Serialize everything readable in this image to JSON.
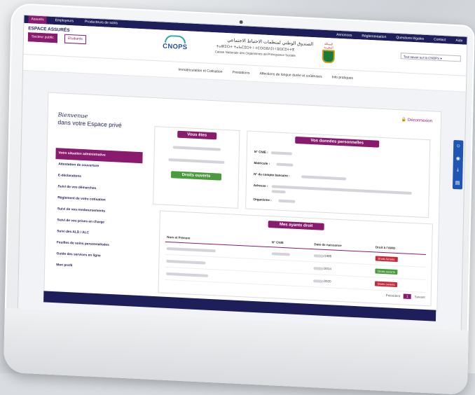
{
  "topbar": {
    "tabs": [
      "Assurés",
      "Employeurs",
      "Producteurs de soins"
    ],
    "right_links": [
      "Annonces",
      "Réglementation",
      "Questions légales",
      "Contact",
      "Aide"
    ]
  },
  "header": {
    "espace_title": "ESPACE ASSURÉS",
    "sector_public": "Secteur public",
    "students": "Etudiants",
    "logo_text": "CNOPS",
    "arabic_name": "الصندوق الوطني لمنظمات الاحتياط الاجتماعي",
    "tifinagh_name": "ⵜⴰⵏⴽⵉⵔⵜ ⵜⴰⵏⴰⵎⵓⵔⵜ ⵏ ⵜⵎⵙⵙⵓⴷⵉⵏ ⵏ ⵓⵙⵎⵓⵜⵜⴳ",
    "french_name": "Caisse Nationale des Organismes de Prévoyance Sociale",
    "emblem_label": "المملكة المغربية",
    "search_label": "Tout savoir sur la CNOPS"
  },
  "nav": [
    "Immatriculation et Cotisation",
    "Prestations",
    "Affections de longue durée et coûteuses",
    "Info pratiques"
  ],
  "deconnexion": "Déconnexion",
  "welcome": {
    "line1": "Bienvenue",
    "line2": "dans votre Espace privé"
  },
  "menu": [
    "Votre situation administrative",
    "Attestation de couverture",
    "E-déclarations",
    "Suivi de vos démarches",
    "Règlement de votre cotisation",
    "Suivi de vos remboursements",
    "Suivi de vos prises en charge",
    "Suivi des ALD / ALC",
    "Feuilles de soins personnalisées",
    "Guide des services en ligne",
    "Mon profil"
  ],
  "vous_etes": {
    "title": "Vous êtes",
    "status": "Droits ouverts"
  },
  "donnees": {
    "title": "Vos données personnelles",
    "fields": [
      "N° CNIE :",
      "Matricule :",
      "N° du compte bancaire :",
      "Adresse :",
      "Organisme :"
    ]
  },
  "ayants": {
    "title": "Mes ayants droit",
    "headers": [
      "Nom et Prénom",
      "N° CNIE",
      "Date de naissance",
      "Droit à l'AMO"
    ],
    "rows": [
      {
        "date": "/1985",
        "droit": "Droits fermés",
        "color": "#c62a3a"
      },
      {
        "date": "/2014",
        "droit": "Droits ouverts",
        "color": "#4a9a3e"
      },
      {
        "date": "/2020",
        "droit": "Droits ouverts",
        "color": "#c62a3a"
      }
    ]
  },
  "pager": {
    "prev": "Précédent",
    "page": "1",
    "next": "Suivant"
  },
  "side_icons": [
    "user-icon",
    "location-icon",
    "download-icon",
    "book-icon"
  ]
}
